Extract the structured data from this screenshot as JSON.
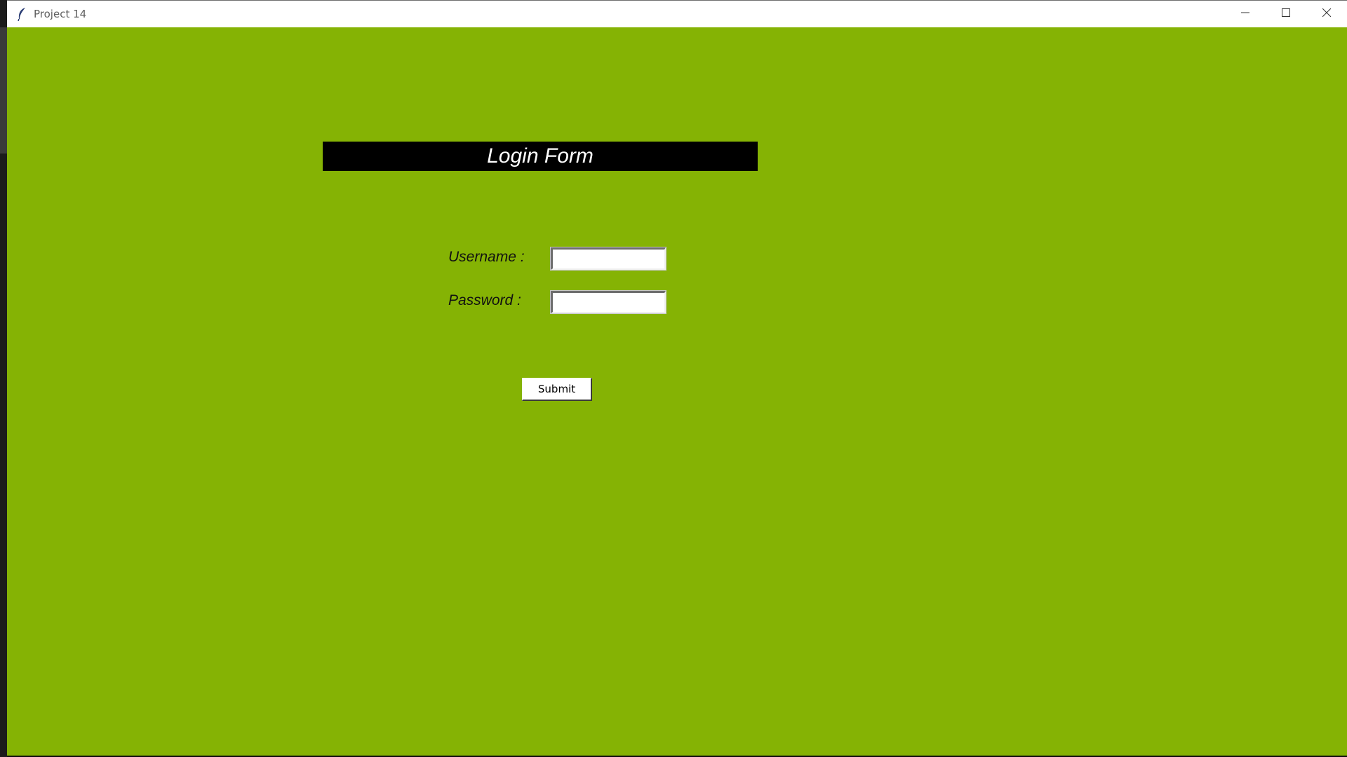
{
  "window": {
    "title": "Project 14",
    "app_icon": "feather-icon",
    "controls": [
      "minimize-icon",
      "maximize-icon",
      "close-icon"
    ]
  },
  "form": {
    "title": "Login Form",
    "username_label": "Username :",
    "username_value": "",
    "password_label": "Password :",
    "password_value": "",
    "submit_label": "Submit"
  },
  "colors": {
    "background": "#85b304",
    "header_bg": "#000000",
    "header_text": "#ffffff"
  }
}
